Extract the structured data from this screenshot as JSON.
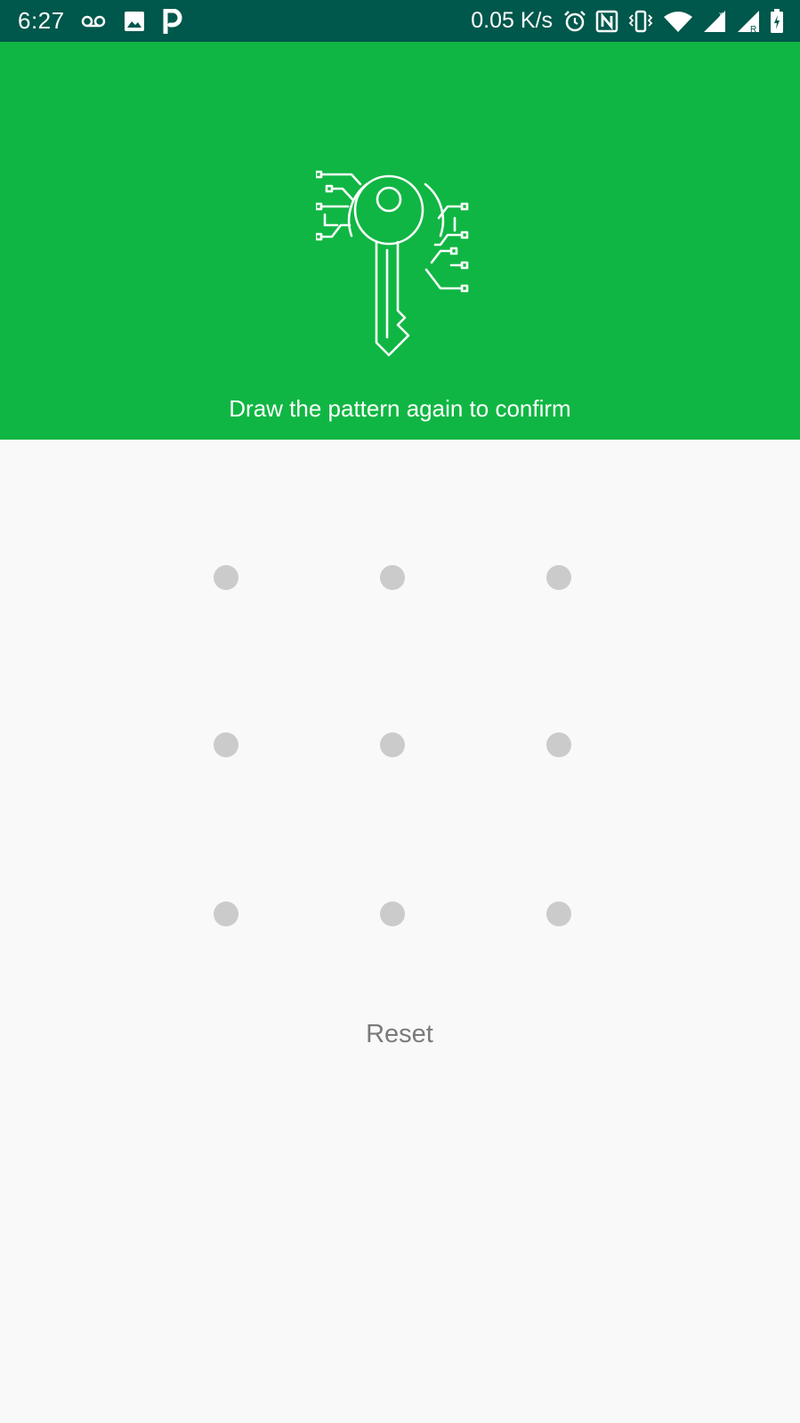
{
  "status_bar": {
    "time": "6:27",
    "network_speed": "0.05 K/s",
    "left_icons": [
      "voicemail-icon",
      "gallery-icon",
      "parking-app-icon"
    ],
    "right_icons": [
      "alarm-icon",
      "nfc-icon",
      "vibrate-icon",
      "wifi-icon",
      "cell-signal-icon",
      "cell-signal-roaming-icon",
      "battery-charging-icon"
    ],
    "background_color": "#00574b"
  },
  "header": {
    "background_color": "#10b643",
    "illustration_icon": "digital-key-icon",
    "instruction": "Draw the pattern again to confirm"
  },
  "pattern": {
    "rows": 3,
    "cols": 3,
    "dot_color": "#cbcbcb"
  },
  "reset_label": "Reset"
}
